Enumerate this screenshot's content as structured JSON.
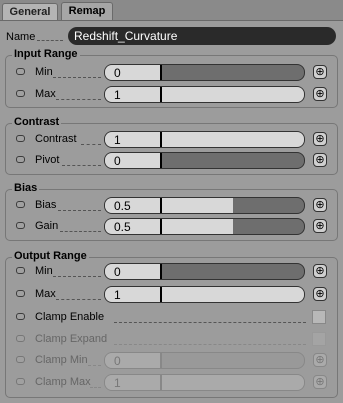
{
  "tabs": [
    {
      "label": "General",
      "active": false
    },
    {
      "label": "Remap",
      "active": true
    }
  ],
  "name": {
    "label": "Name",
    "value": "Redshift_Curvature"
  },
  "connect_icon": "plug-connector-icon",
  "colors": {
    "panel": "#9c9c9c",
    "field_fill": "#d8d8d8",
    "field_track": "#6e6e6e",
    "name_field": "#2a2a2a"
  },
  "groups": {
    "input_range": {
      "title": "Input Range",
      "min": {
        "label": "Min",
        "value": "0",
        "level": 0.0
      },
      "max": {
        "label": "Max",
        "value": "1",
        "level": 1.0
      }
    },
    "contrast": {
      "title": "Contrast",
      "contrast": {
        "label": "Contrast",
        "value": "1",
        "level": 1.0
      },
      "pivot": {
        "label": "Pivot",
        "value": "0",
        "level": 0.0
      }
    },
    "bias": {
      "title": "Bias",
      "bias": {
        "label": "Bias",
        "value": "0.5",
        "level": 0.5
      },
      "gain": {
        "label": "Gain",
        "value": "0.5",
        "level": 0.5
      }
    },
    "output_range": {
      "title": "Output Range",
      "min": {
        "label": "Min",
        "value": "0",
        "level": 0.0
      },
      "max": {
        "label": "Max",
        "value": "1",
        "level": 1.0
      },
      "clamp_enable": {
        "label": "Clamp Enable",
        "checked": false
      },
      "clamp_expand": {
        "label": "Clamp Expand",
        "checked": false
      },
      "clamp_min": {
        "label": "Clamp Min",
        "value": "0",
        "level": 0.0
      },
      "clamp_max": {
        "label": "Clamp Max",
        "value": "1",
        "level": 1.0
      }
    }
  }
}
